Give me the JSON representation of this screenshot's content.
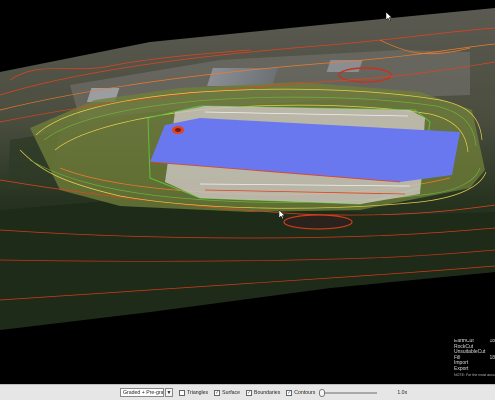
{
  "legend": {
    "rows": [
      {
        "label": "EarthCut",
        "value": "18"
      },
      {
        "label": "RockCut",
        "value": ""
      },
      {
        "label": "UnsuitableCut",
        "value": ""
      },
      {
        "label": "Fill",
        "value": "18"
      },
      {
        "label": "Import",
        "value": ""
      },
      {
        "label": "Export",
        "value": ""
      }
    ],
    "note": "NOTE: For the most accu"
  },
  "toolbar": {
    "surface_select": "Graded + Pre-graded Rock",
    "dropdown_glyph": "▼",
    "checkboxes": [
      {
        "label": "Triangles",
        "checked": false
      },
      {
        "label": "Surface",
        "checked": true
      },
      {
        "label": "Boundaries",
        "checked": true
      },
      {
        "label": "Contours",
        "checked": true
      }
    ],
    "slider_value": 0,
    "zoom": "1.0x"
  },
  "colors": {
    "pad": "#6a78ef",
    "contour_red": "#e3421c",
    "contour_orange": "#f07a2a",
    "contour_yellow": "#e7d04a",
    "contour_green": "#6fae3e",
    "background": "#000000"
  }
}
